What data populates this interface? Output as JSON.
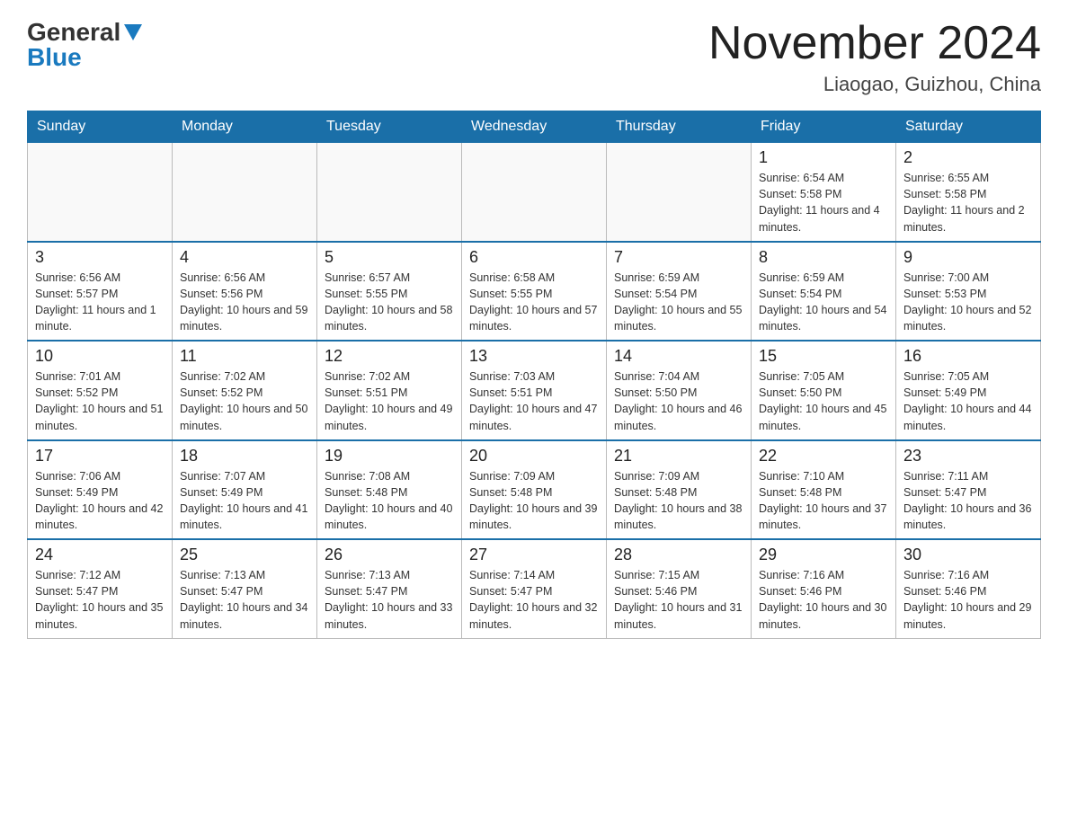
{
  "header": {
    "logo_general": "General",
    "logo_blue": "Blue",
    "month_title": "November 2024",
    "location": "Liaogao, Guizhou, China"
  },
  "weekdays": [
    "Sunday",
    "Monday",
    "Tuesday",
    "Wednesday",
    "Thursday",
    "Friday",
    "Saturday"
  ],
  "weeks": [
    [
      {
        "num": "",
        "sunrise": "",
        "sunset": "",
        "daylight": "",
        "empty": true
      },
      {
        "num": "",
        "sunrise": "",
        "sunset": "",
        "daylight": "",
        "empty": true
      },
      {
        "num": "",
        "sunrise": "",
        "sunset": "",
        "daylight": "",
        "empty": true
      },
      {
        "num": "",
        "sunrise": "",
        "sunset": "",
        "daylight": "",
        "empty": true
      },
      {
        "num": "",
        "sunrise": "",
        "sunset": "",
        "daylight": "",
        "empty": true
      },
      {
        "num": "1",
        "sunrise": "Sunrise: 6:54 AM",
        "sunset": "Sunset: 5:58 PM",
        "daylight": "Daylight: 11 hours and 4 minutes.",
        "empty": false
      },
      {
        "num": "2",
        "sunrise": "Sunrise: 6:55 AM",
        "sunset": "Sunset: 5:58 PM",
        "daylight": "Daylight: 11 hours and 2 minutes.",
        "empty": false
      }
    ],
    [
      {
        "num": "3",
        "sunrise": "Sunrise: 6:56 AM",
        "sunset": "Sunset: 5:57 PM",
        "daylight": "Daylight: 11 hours and 1 minute.",
        "empty": false
      },
      {
        "num": "4",
        "sunrise": "Sunrise: 6:56 AM",
        "sunset": "Sunset: 5:56 PM",
        "daylight": "Daylight: 10 hours and 59 minutes.",
        "empty": false
      },
      {
        "num": "5",
        "sunrise": "Sunrise: 6:57 AM",
        "sunset": "Sunset: 5:55 PM",
        "daylight": "Daylight: 10 hours and 58 minutes.",
        "empty": false
      },
      {
        "num": "6",
        "sunrise": "Sunrise: 6:58 AM",
        "sunset": "Sunset: 5:55 PM",
        "daylight": "Daylight: 10 hours and 57 minutes.",
        "empty": false
      },
      {
        "num": "7",
        "sunrise": "Sunrise: 6:59 AM",
        "sunset": "Sunset: 5:54 PM",
        "daylight": "Daylight: 10 hours and 55 minutes.",
        "empty": false
      },
      {
        "num": "8",
        "sunrise": "Sunrise: 6:59 AM",
        "sunset": "Sunset: 5:54 PM",
        "daylight": "Daylight: 10 hours and 54 minutes.",
        "empty": false
      },
      {
        "num": "9",
        "sunrise": "Sunrise: 7:00 AM",
        "sunset": "Sunset: 5:53 PM",
        "daylight": "Daylight: 10 hours and 52 minutes.",
        "empty": false
      }
    ],
    [
      {
        "num": "10",
        "sunrise": "Sunrise: 7:01 AM",
        "sunset": "Sunset: 5:52 PM",
        "daylight": "Daylight: 10 hours and 51 minutes.",
        "empty": false
      },
      {
        "num": "11",
        "sunrise": "Sunrise: 7:02 AM",
        "sunset": "Sunset: 5:52 PM",
        "daylight": "Daylight: 10 hours and 50 minutes.",
        "empty": false
      },
      {
        "num": "12",
        "sunrise": "Sunrise: 7:02 AM",
        "sunset": "Sunset: 5:51 PM",
        "daylight": "Daylight: 10 hours and 49 minutes.",
        "empty": false
      },
      {
        "num": "13",
        "sunrise": "Sunrise: 7:03 AM",
        "sunset": "Sunset: 5:51 PM",
        "daylight": "Daylight: 10 hours and 47 minutes.",
        "empty": false
      },
      {
        "num": "14",
        "sunrise": "Sunrise: 7:04 AM",
        "sunset": "Sunset: 5:50 PM",
        "daylight": "Daylight: 10 hours and 46 minutes.",
        "empty": false
      },
      {
        "num": "15",
        "sunrise": "Sunrise: 7:05 AM",
        "sunset": "Sunset: 5:50 PM",
        "daylight": "Daylight: 10 hours and 45 minutes.",
        "empty": false
      },
      {
        "num": "16",
        "sunrise": "Sunrise: 7:05 AM",
        "sunset": "Sunset: 5:49 PM",
        "daylight": "Daylight: 10 hours and 44 minutes.",
        "empty": false
      }
    ],
    [
      {
        "num": "17",
        "sunrise": "Sunrise: 7:06 AM",
        "sunset": "Sunset: 5:49 PM",
        "daylight": "Daylight: 10 hours and 42 minutes.",
        "empty": false
      },
      {
        "num": "18",
        "sunrise": "Sunrise: 7:07 AM",
        "sunset": "Sunset: 5:49 PM",
        "daylight": "Daylight: 10 hours and 41 minutes.",
        "empty": false
      },
      {
        "num": "19",
        "sunrise": "Sunrise: 7:08 AM",
        "sunset": "Sunset: 5:48 PM",
        "daylight": "Daylight: 10 hours and 40 minutes.",
        "empty": false
      },
      {
        "num": "20",
        "sunrise": "Sunrise: 7:09 AM",
        "sunset": "Sunset: 5:48 PM",
        "daylight": "Daylight: 10 hours and 39 minutes.",
        "empty": false
      },
      {
        "num": "21",
        "sunrise": "Sunrise: 7:09 AM",
        "sunset": "Sunset: 5:48 PM",
        "daylight": "Daylight: 10 hours and 38 minutes.",
        "empty": false
      },
      {
        "num": "22",
        "sunrise": "Sunrise: 7:10 AM",
        "sunset": "Sunset: 5:48 PM",
        "daylight": "Daylight: 10 hours and 37 minutes.",
        "empty": false
      },
      {
        "num": "23",
        "sunrise": "Sunrise: 7:11 AM",
        "sunset": "Sunset: 5:47 PM",
        "daylight": "Daylight: 10 hours and 36 minutes.",
        "empty": false
      }
    ],
    [
      {
        "num": "24",
        "sunrise": "Sunrise: 7:12 AM",
        "sunset": "Sunset: 5:47 PM",
        "daylight": "Daylight: 10 hours and 35 minutes.",
        "empty": false
      },
      {
        "num": "25",
        "sunrise": "Sunrise: 7:13 AM",
        "sunset": "Sunset: 5:47 PM",
        "daylight": "Daylight: 10 hours and 34 minutes.",
        "empty": false
      },
      {
        "num": "26",
        "sunrise": "Sunrise: 7:13 AM",
        "sunset": "Sunset: 5:47 PM",
        "daylight": "Daylight: 10 hours and 33 minutes.",
        "empty": false
      },
      {
        "num": "27",
        "sunrise": "Sunrise: 7:14 AM",
        "sunset": "Sunset: 5:47 PM",
        "daylight": "Daylight: 10 hours and 32 minutes.",
        "empty": false
      },
      {
        "num": "28",
        "sunrise": "Sunrise: 7:15 AM",
        "sunset": "Sunset: 5:46 PM",
        "daylight": "Daylight: 10 hours and 31 minutes.",
        "empty": false
      },
      {
        "num": "29",
        "sunrise": "Sunrise: 7:16 AM",
        "sunset": "Sunset: 5:46 PM",
        "daylight": "Daylight: 10 hours and 30 minutes.",
        "empty": false
      },
      {
        "num": "30",
        "sunrise": "Sunrise: 7:16 AM",
        "sunset": "Sunset: 5:46 PM",
        "daylight": "Daylight: 10 hours and 29 minutes.",
        "empty": false
      }
    ]
  ]
}
